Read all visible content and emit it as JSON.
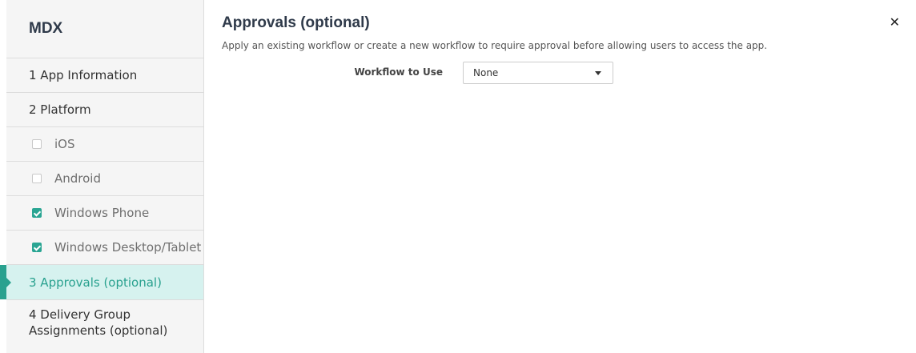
{
  "sidebar": {
    "title": "MDX",
    "items": [
      {
        "label": "1 App Information"
      },
      {
        "label": "2 Platform"
      },
      {
        "label": "iOS",
        "checked": false
      },
      {
        "label": "Android",
        "checked": false
      },
      {
        "label": "Windows Phone",
        "checked": true
      },
      {
        "label": "Windows Desktop/Tablet",
        "checked": true
      },
      {
        "label": "3 Approvals (optional)",
        "active": true
      },
      {
        "label": "4 Delivery Group Assignments (optional)"
      }
    ]
  },
  "main": {
    "title": "Approvals (optional)",
    "subtitle": "Apply an existing workflow or create a new workflow to require approval before allowing users to access the app.",
    "close_icon": "close-icon",
    "workflow": {
      "label": "Workflow to Use",
      "value": "None"
    }
  },
  "colors": {
    "accent": "#29a18f",
    "active_bg": "#d6f2ef",
    "checkbox_checked": "#2aa593"
  }
}
